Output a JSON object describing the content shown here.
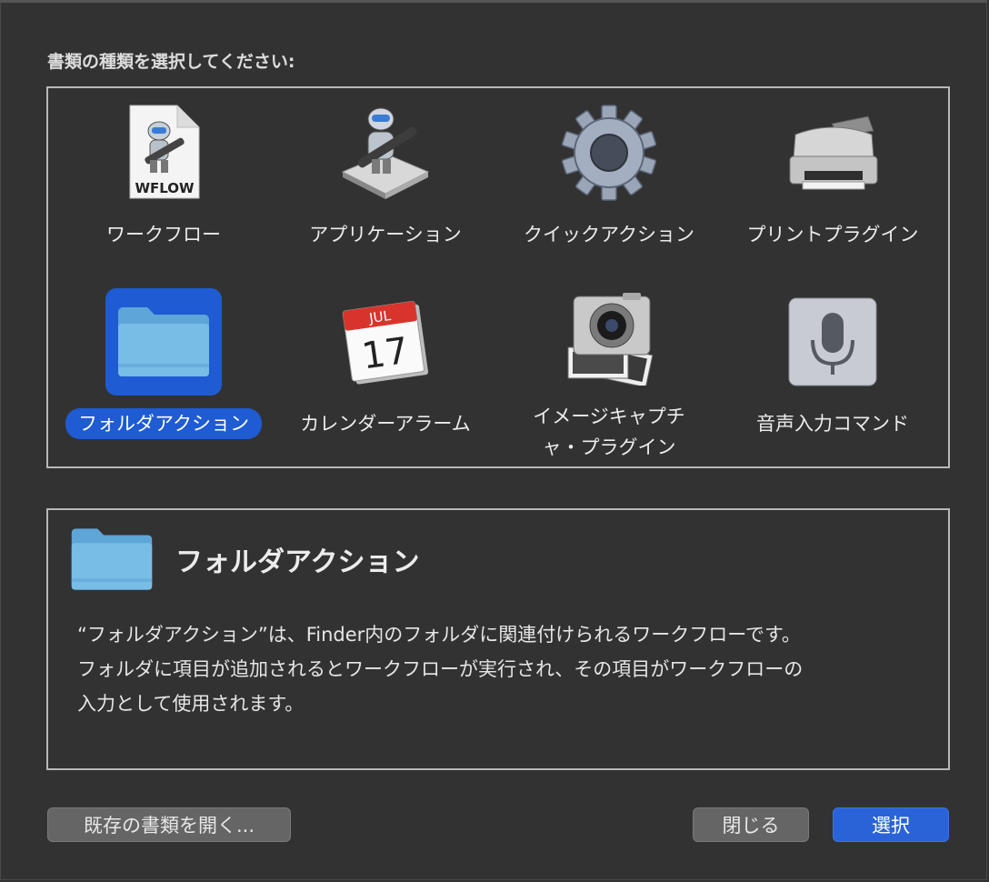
{
  "dialog": {
    "prompt": "書類の種類を選択してください:"
  },
  "types": [
    {
      "label": "ワークフロー",
      "icon": "workflow-document-icon",
      "selected": false
    },
    {
      "label": "アプリケーション",
      "icon": "automator-robot-icon",
      "selected": false
    },
    {
      "label": "クイックアクション",
      "icon": "gear-icon",
      "selected": false
    },
    {
      "label": "プリントプラグイン",
      "icon": "printer-icon",
      "selected": false
    },
    {
      "label": "フォルダアクション",
      "icon": "folder-icon",
      "selected": true
    },
    {
      "label": "カレンダーアラーム",
      "icon": "calendar-icon",
      "selected": false
    },
    {
      "label": "イメージキャプチャ・プラグイン",
      "icon": "image-capture-camera-icon",
      "selected": false
    },
    {
      "label": "音声入力コマンド",
      "icon": "microphone-icon",
      "selected": false
    }
  ],
  "workflow_icon_text": "WFLOW",
  "calendar": {
    "month": "JUL",
    "day": "17"
  },
  "description": {
    "title": "フォルダアクション",
    "text_line1": "“フォルダアクション”は、Finder内のフォルダに関連付けられるワークフローです。",
    "text_line2": "フォルダに項目が追加されるとワークフローが実行され、その項目がワークフローの",
    "text_line3": "入力として使用されます。"
  },
  "buttons": {
    "open_existing": "既存の書類を開く...",
    "close": "閉じる",
    "choose": "選択"
  },
  "colors": {
    "background": "#323232",
    "accent": "#1f5bd2",
    "folder": "#6fb2de"
  }
}
